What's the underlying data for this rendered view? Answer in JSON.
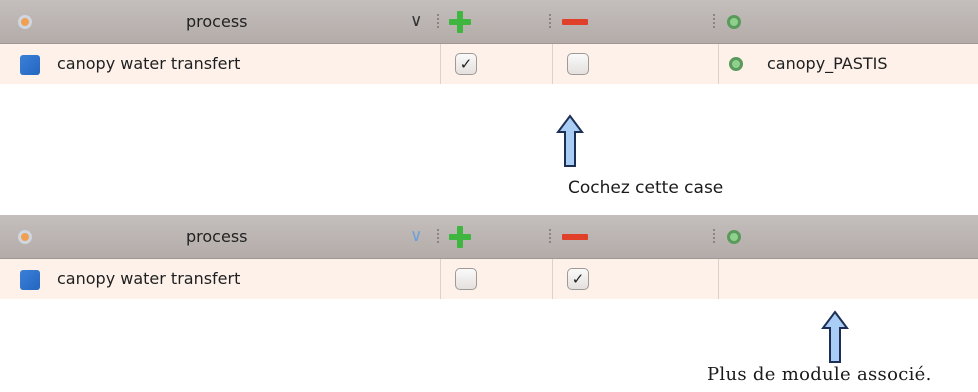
{
  "colors": {
    "header_bg": "#bcb6b3",
    "row_bg": "#fdf1ea",
    "plus": "#3fb63f",
    "minus": "#e0402a",
    "arrow_fill": "#a9cdf5"
  },
  "tables": [
    {
      "header": {
        "icon": "gear-icon",
        "title": "process",
        "chevron": "chevron-down-icon",
        "add": "plus-icon",
        "remove": "minus-icon",
        "module": "gear-icon"
      },
      "row": {
        "icon": "blue-square-icon",
        "label": "canopy water transfert",
        "add_checked": true,
        "remove_checked": false,
        "module": "canopy_PASTIS"
      }
    },
    {
      "header": {
        "icon": "gear-icon",
        "title": "process",
        "chevron": "chevron-down-icon",
        "add": "plus-icon",
        "remove": "minus-icon",
        "module": "gear-icon"
      },
      "row": {
        "icon": "blue-square-icon",
        "label": "canopy water transfert",
        "add_checked": false,
        "remove_checked": true,
        "module": ""
      }
    }
  ],
  "annotations": {
    "caption_1": "Cochez cette case",
    "caption_2": "Plus de module associé."
  },
  "glyphs": {
    "check": "✓",
    "chevron": "∨"
  }
}
